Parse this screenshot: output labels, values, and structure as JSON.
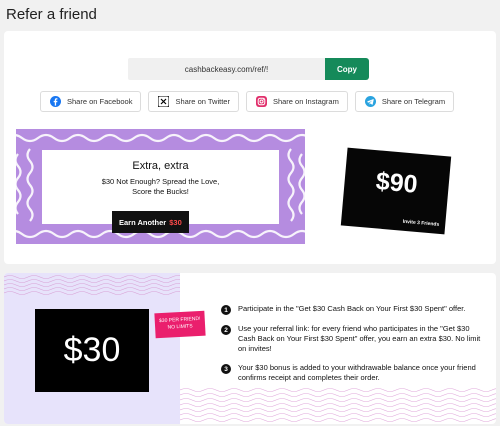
{
  "page": {
    "title": "Refer a friend"
  },
  "referral": {
    "link": "cashbackeasy.com/ref/!",
    "copy_label": "Copy"
  },
  "share": [
    {
      "label": "Share on Facebook",
      "icon": "facebook-icon",
      "color": "#1877f2"
    },
    {
      "label": "Share on Twitter",
      "icon": "x-twitter-icon",
      "color": "#000000"
    },
    {
      "label": "Share on Instagram",
      "icon": "instagram-icon",
      "color": "#e1306c"
    },
    {
      "label": "Share on Telegram",
      "icon": "telegram-icon",
      "color": "#2aa3df"
    }
  ],
  "promo": {
    "title": "Extra, extra",
    "line1": "$30 Not Enough? Spread the Love,",
    "line2": "Score the Bucks!",
    "button_text": "Earn Another",
    "button_amount": "$30"
  },
  "bonus": {
    "amount": "$90",
    "caption": "Invite 3 Friends"
  },
  "reward": {
    "amount": "$30",
    "tag_line1": "$30 PER FRIEND!",
    "tag_line2": "NO LIMITS"
  },
  "steps": [
    {
      "num": "1",
      "text": "Participate in the \"Get $30 Cash Back on Your First $30 Spent\" offer."
    },
    {
      "num": "2",
      "text": "Use your referral link: for every friend who participates in the \"Get $30 Cash Back on Your First $30 Spent\" offer, you earn an extra $30. No limit on invites!"
    },
    {
      "num": "3",
      "text": "Your $30 bonus is added to your withdrawable balance once your friend confirms receipt and completes their order."
    }
  ],
  "colors": {
    "accent": "#158a5a",
    "promo_bg": "#b58ce0",
    "tag": "#ea1f6d",
    "panel": "#e7e3fb"
  }
}
